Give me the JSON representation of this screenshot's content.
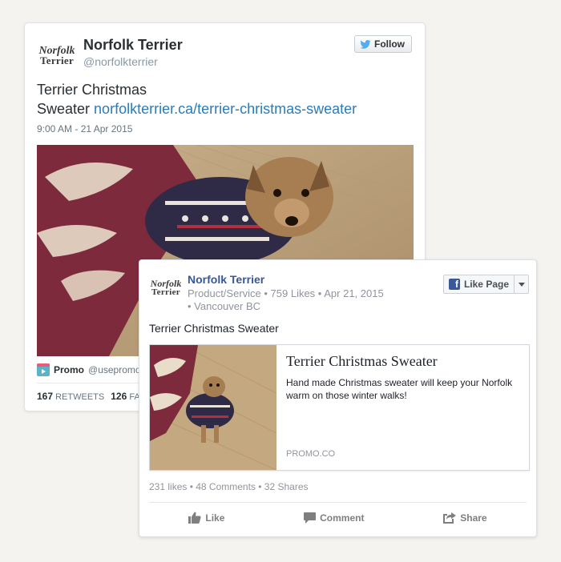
{
  "twitter": {
    "logo": {
      "line1": "Norfolk",
      "line2": "Terrier"
    },
    "name": "Norfolk Terrier",
    "handle": "@norfolkterrier",
    "follow_label": "Follow",
    "text_line1": "Terrier Christmas",
    "text_line2_prefix": "Sweater ",
    "link": "norfolkterrier.ca/terrier-christmas-sweater",
    "timestamp": "9:00 AM - 21 Apr 2015",
    "promo": {
      "brand": "Promo",
      "handle": "@usepromo"
    },
    "stats": {
      "retweets_count": "167",
      "retweets_label": "RETWEETS",
      "favorites_count": "126",
      "favorites_label": "FAVO"
    },
    "icons": {
      "bird": "twitter-bird-icon",
      "promo": "promo-app-icon"
    }
  },
  "facebook": {
    "logo": {
      "line1": "Norfolk",
      "line2": "Terrier"
    },
    "page_name": "Norfolk Terrier",
    "meta_line1": "Product/Service • 759 Likes • Apr 21, 2015",
    "meta_line2": "• Vancouver BC",
    "like_page_label": "Like Page",
    "post_text": "Terrier Christmas Sweater",
    "preview": {
      "title": "Terrier Christmas Sweater",
      "description": "Hand made Christmas sweater will keep your Norfolk warm on those winter walks!",
      "domain": "PROMO.CO"
    },
    "stats_text": "231 likes • 48 Comments • 32 Shares",
    "actions": {
      "like": "Like",
      "comment": "Comment",
      "share": "Share"
    },
    "colors": {
      "brand": "#3b5998",
      "link": "#365899"
    }
  },
  "colors": {
    "twitter_link": "#2b7bb9",
    "twitter_bird": "#55acee",
    "background": "#f5f3ef"
  }
}
